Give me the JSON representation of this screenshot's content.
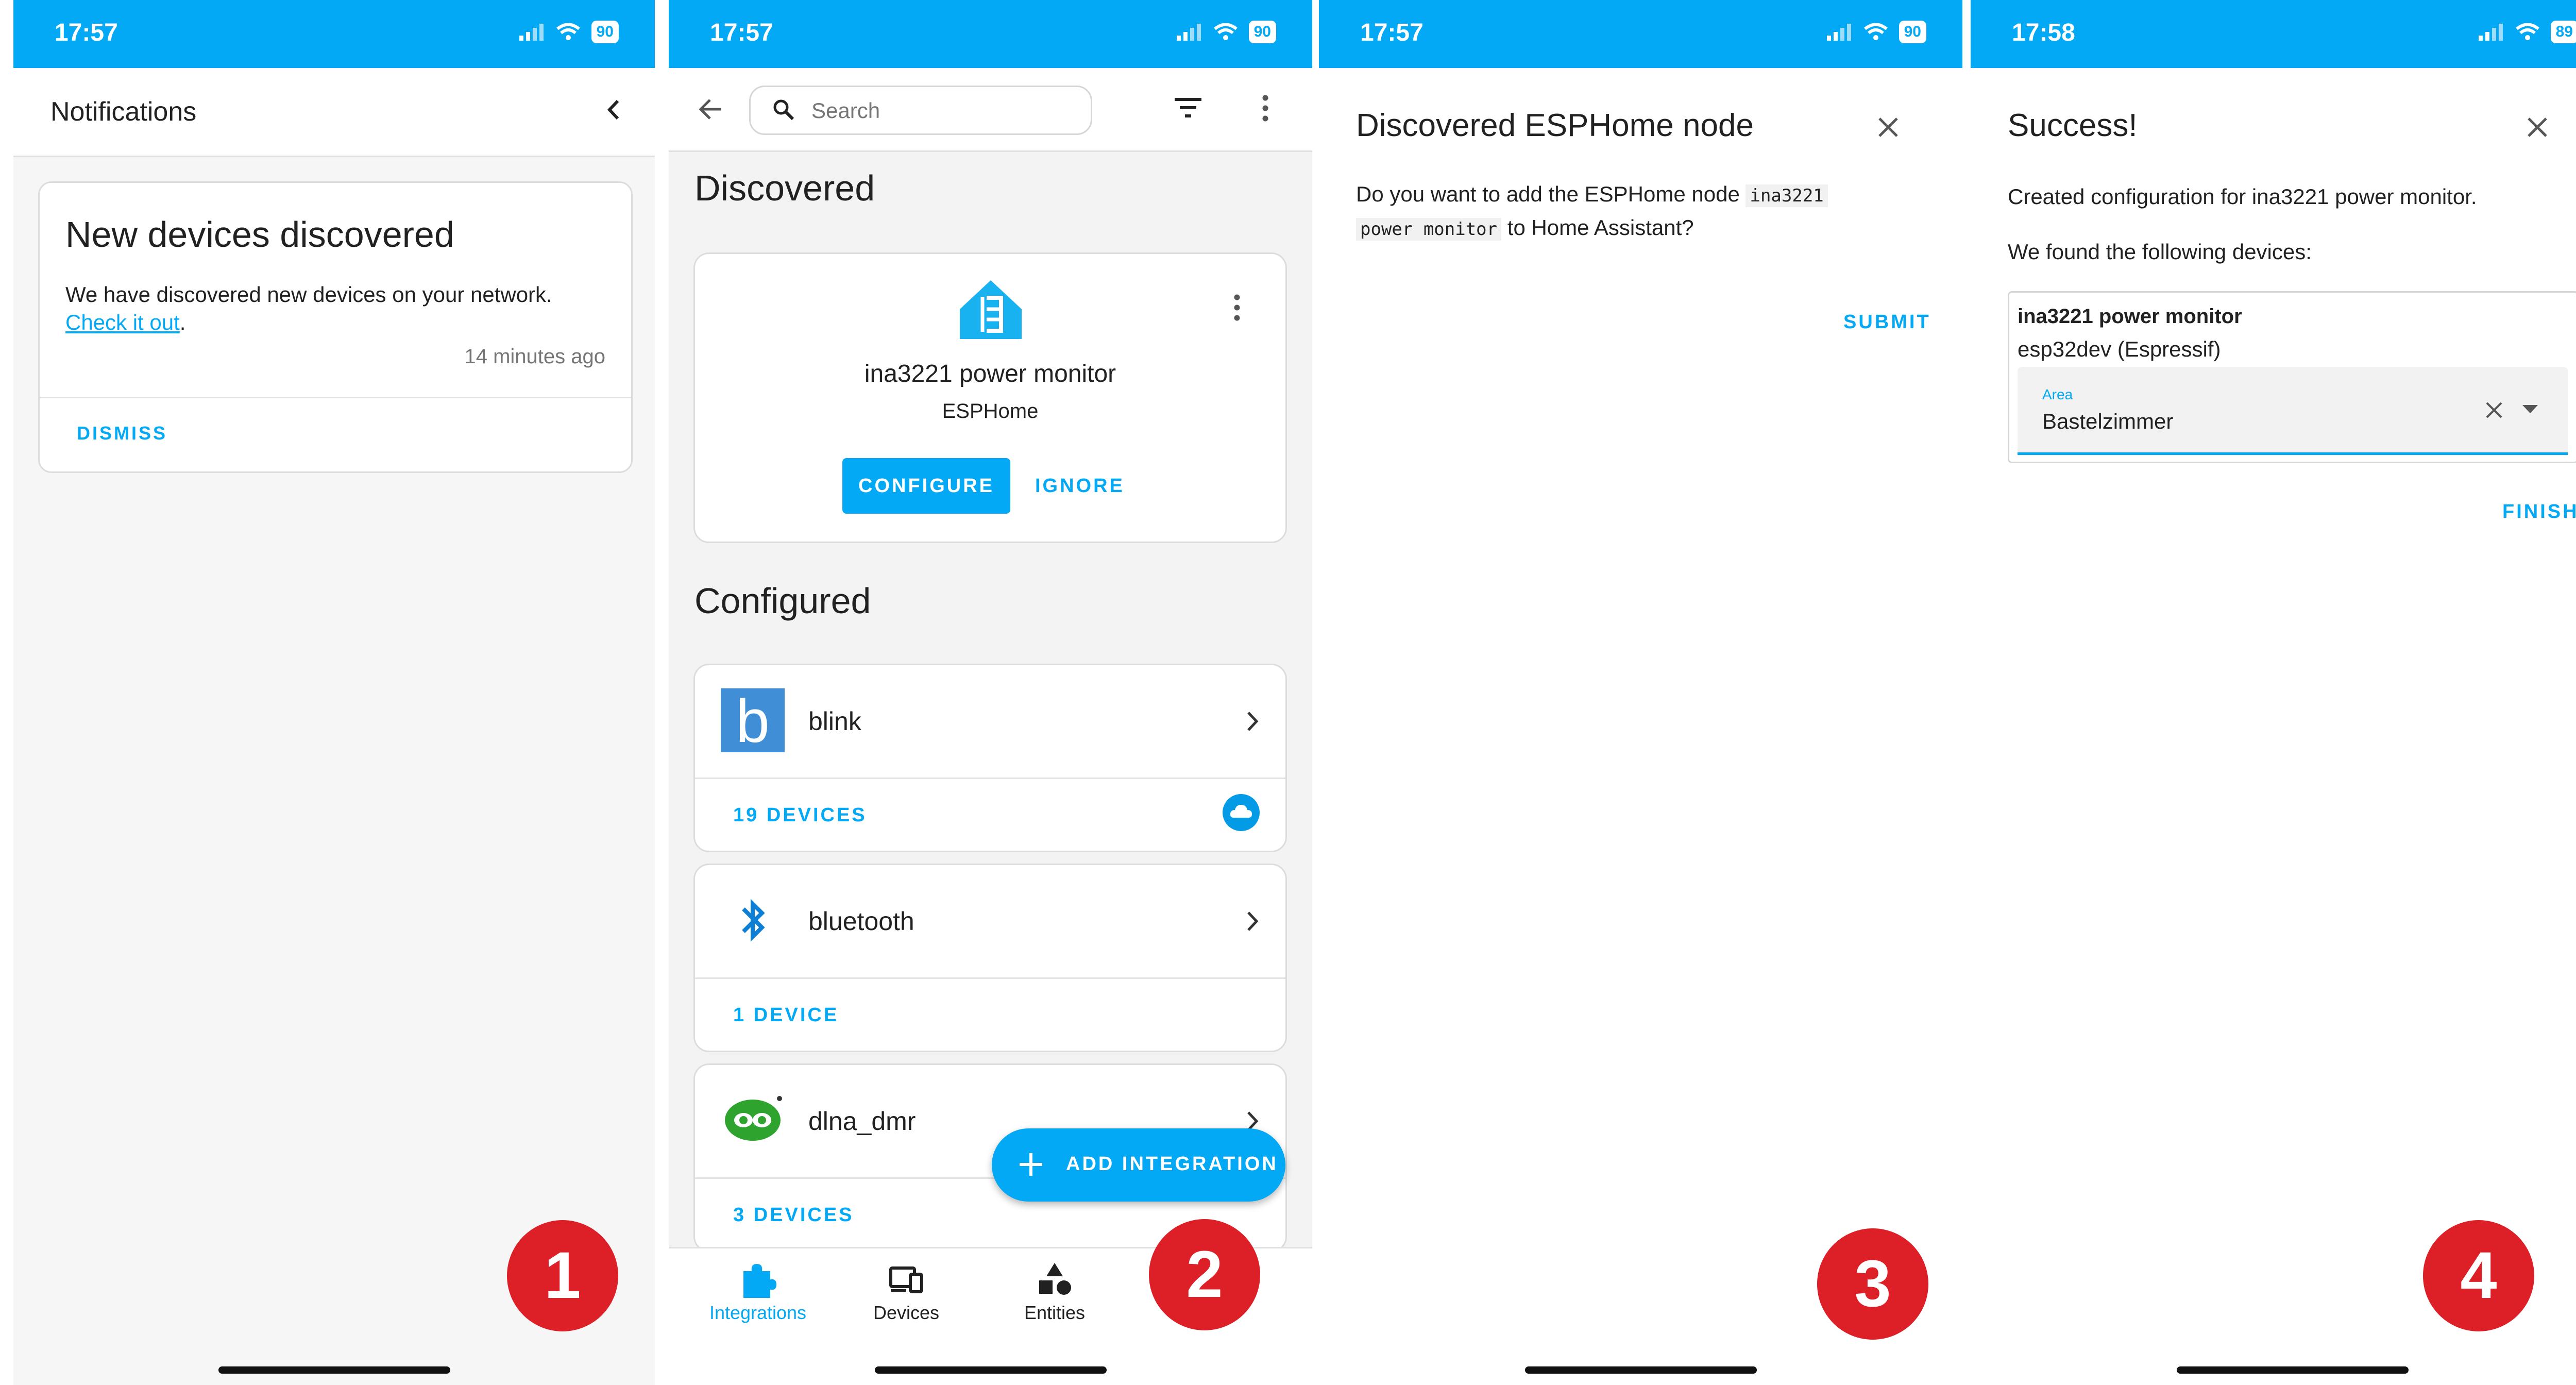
{
  "colors": {
    "accent": "#03a9f4",
    "badge": "#dd1f27"
  },
  "panel1": {
    "status": {
      "time": "17:57",
      "battery": "90"
    },
    "header_title": "Notifications",
    "card": {
      "title": "New devices discovered",
      "text": "We have discovered new devices on your network.",
      "link": "Check it out",
      "after_link": ".",
      "time": "14 minutes ago",
      "dismiss": "DISMISS"
    },
    "step": "1"
  },
  "panel2": {
    "status": {
      "time": "17:57",
      "battery": "90"
    },
    "search_placeholder": "Search",
    "discovered_heading": "Discovered",
    "discovered_card": {
      "name": "ina3221 power monitor",
      "integration": "ESPHome",
      "configure": "CONFIGURE",
      "ignore": "IGNORE"
    },
    "configured_heading": "Configured",
    "integrations": [
      {
        "name": "blink",
        "devices": "19 DEVICES",
        "icon": "blink-logo-icon"
      },
      {
        "name": "bluetooth",
        "devices": "1 DEVICE",
        "icon": "bluetooth-icon"
      },
      {
        "name": "dlna_dmr",
        "devices": "3 DEVICES",
        "icon": "dlna-logo-icon"
      }
    ],
    "fab_label": "ADD INTEGRATION",
    "nav": [
      {
        "label": "Integrations",
        "icon": "puzzle-icon",
        "active": true
      },
      {
        "label": "Devices",
        "icon": "devices-icon",
        "active": false
      },
      {
        "label": "Entities",
        "icon": "shapes-icon",
        "active": false
      }
    ],
    "step": "2"
  },
  "panel3": {
    "status": {
      "time": "17:57",
      "battery": "90"
    },
    "title": "Discovered ESPHome node",
    "text_before": "Do you want to add the ESPHome node",
    "code1": "ina3221",
    "code2": "power monitor",
    "text_after": "to Home Assistant?",
    "submit": "SUBMIT",
    "step": "3"
  },
  "panel4": {
    "status": {
      "time": "17:58",
      "battery": "89"
    },
    "title": "Success!",
    "text1": "Created configuration for ina3221 power monitor.",
    "text2": "We found the following devices:",
    "device_name": "ina3221 power monitor",
    "device_model": "esp32dev (Espressif)",
    "area_label": "Area",
    "area_value": "Bastelzimmer",
    "finish": "FINISH",
    "step": "4"
  }
}
